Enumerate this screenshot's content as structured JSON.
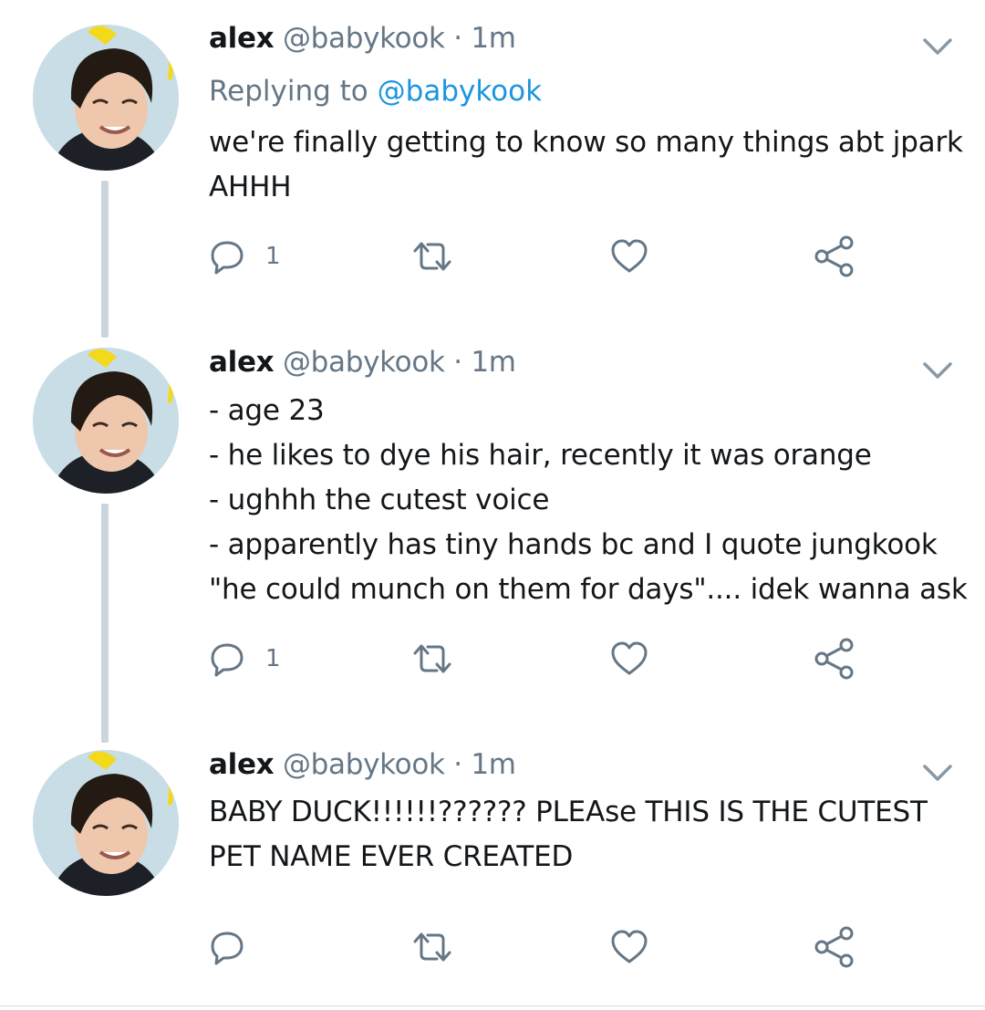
{
  "tweets": [
    {
      "name": "alex",
      "handle": "@babykook",
      "separator": "·",
      "time": "1m",
      "replying_prefix": "Replying to",
      "replying_mention": "@babykook",
      "lines": [
        "we're finally getting to know so many things abt jpark",
        "AHHH"
      ],
      "reply_count": "1"
    },
    {
      "name": "alex",
      "handle": "@babykook",
      "separator": "·",
      "time": "1m",
      "lines": [
        "- age 23",
        "- he likes to dye his hair, recently it was orange",
        "- ughhh the cutest voice",
        "- apparently has tiny hands bc and I quote jungkook",
        "\"he could munch on them for days\".... idek wanna ask"
      ],
      "reply_count": "1"
    },
    {
      "name": "alex",
      "handle": "@babykook",
      "separator": "·",
      "time": "1m",
      "lines": [
        "BABY DUCK!!!!!!?????? PLEAse THIS IS THE CUTEST",
        "PET NAME EVER CREATED"
      ],
      "reply_count": ""
    }
  ],
  "icons": {
    "reply": "reply-icon",
    "retweet": "retweet-icon",
    "like": "heart-icon",
    "share": "share-icon",
    "caret": "chevron-down-icon"
  },
  "colors": {
    "text": "#14171a",
    "secondary": "#657786",
    "mention": "#1b95e0",
    "thread_line": "#cbd5dd",
    "icon": "#657786"
  }
}
